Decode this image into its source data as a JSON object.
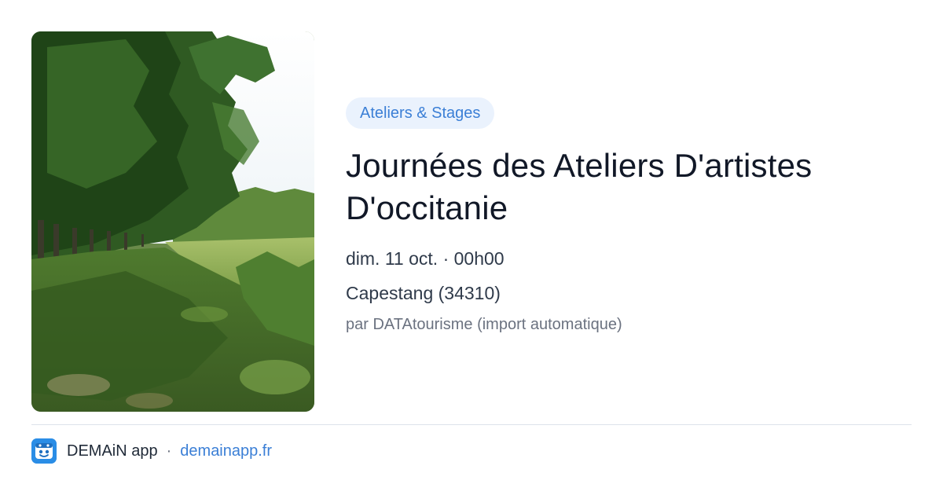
{
  "event": {
    "category": "Ateliers & Stages",
    "title": "Journées des Ateliers D'artistes D'occitanie",
    "date": "dim. 11 oct. · 00h00",
    "location": "Capestang (34310)",
    "source": "par DATAtourisme (import automatique)"
  },
  "footer": {
    "app_name": "DEMAiN app",
    "separator": "·",
    "domain": "demainapp.fr",
    "logo_icon": "demain-logo-icon"
  },
  "colors": {
    "accent": "#3b7fd6",
    "badge_bg": "#eaf2fd",
    "logo_bg": "#2a8de6"
  }
}
